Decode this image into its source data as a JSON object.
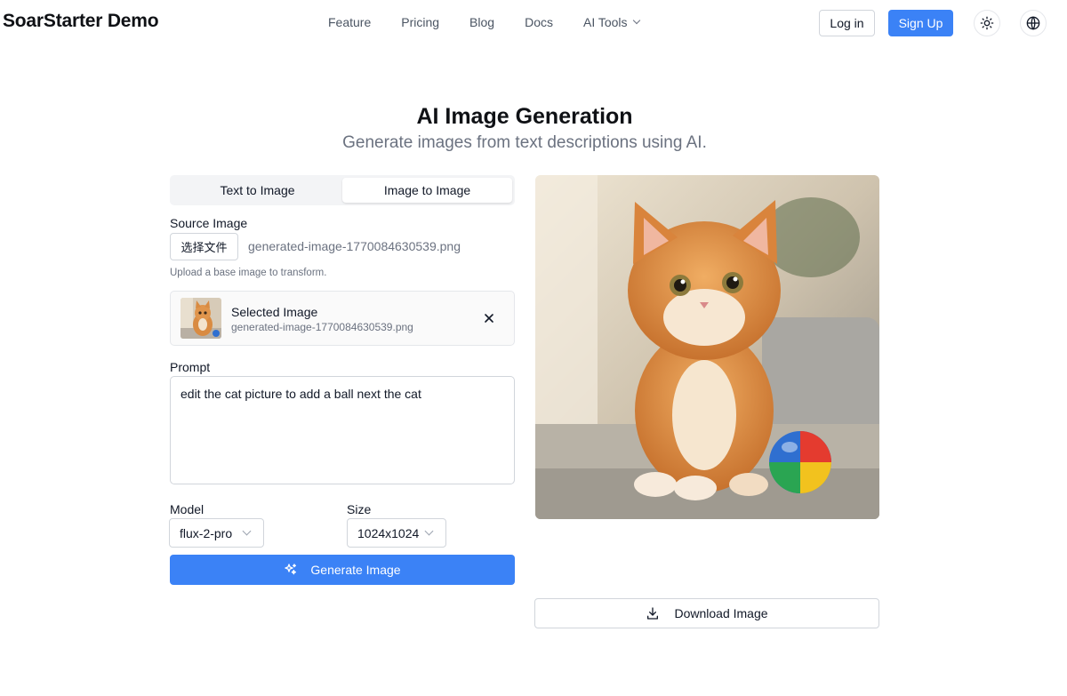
{
  "nav": {
    "brand": "SoarStarter Demo",
    "links": [
      "Feature",
      "Pricing",
      "Blog",
      "Docs",
      "AI Tools"
    ],
    "login": "Log in",
    "signup": "Sign Up"
  },
  "hero": {
    "title": "AI Image Generation",
    "subtitle": "Generate images from text descriptions using AI."
  },
  "form": {
    "tabs": [
      "Text to Image",
      "Image to Image"
    ],
    "active_tab": "Image to Image",
    "source_label": "Source Image",
    "file_button": "选择文件",
    "file_name": "generated-image-1770084630539.png",
    "helper": "Upload a base image to transform.",
    "selected_title": "Selected Image",
    "selected_file": "generated-image-1770084630539.png",
    "prompt_label": "Prompt",
    "prompt_value": "edit the cat picture to add a ball next the cat",
    "model_label": "Model",
    "model_value": "flux-2-pro",
    "size_label": "Size",
    "size_value": "1024x1024",
    "generate": "Generate Image"
  },
  "result": {
    "download": "Download Image"
  },
  "icons": {
    "theme": "sun-icon",
    "language": "globe-icon",
    "remove": "close-icon",
    "generate": "sparkles-icon",
    "download": "download-icon"
  },
  "colors": {
    "primary": "#3b82f6",
    "text": "#111827",
    "muted": "#6b7280",
    "border": "#d1d5db"
  }
}
